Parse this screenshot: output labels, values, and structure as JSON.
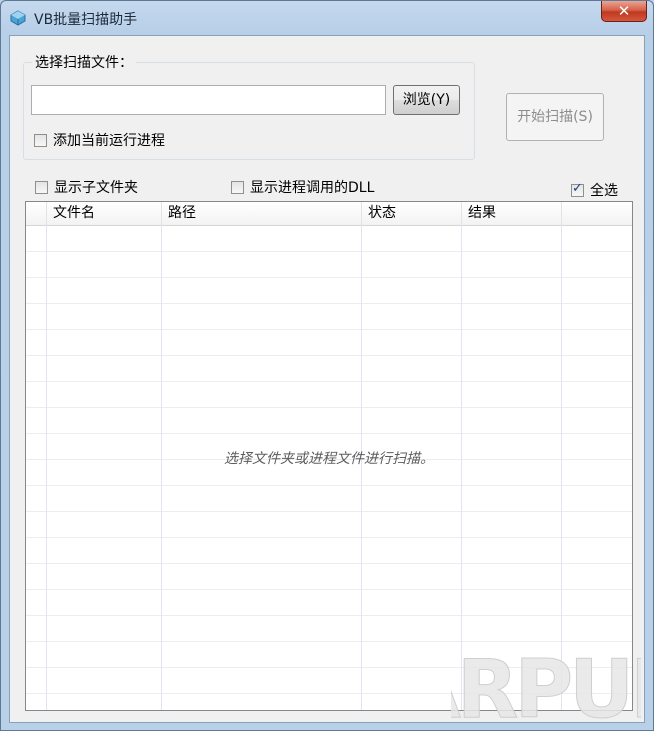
{
  "window": {
    "title": "VB批量扫描助手",
    "close_label": "✕"
  },
  "scan_group": {
    "label": "选择扫描文件：",
    "path_value": "",
    "browse_label": "浏览(Y)",
    "add_running_label": "添加当前运行进程",
    "add_running_checked": false
  },
  "start_scan_label": "开始扫描(S)",
  "options": {
    "show_subfolders_label": "显示子文件夹",
    "show_subfolders_checked": false,
    "show_dll_label": "显示进程调用的DLL",
    "show_dll_checked": false,
    "select_all_label": "全选",
    "select_all_checked": true
  },
  "list": {
    "columns": [
      "",
      "文件名",
      "路径",
      "状态",
      "结果",
      ""
    ],
    "empty_hint": "选择文件夹或进程文件进行扫描。"
  },
  "watermark_text": "ARPUN",
  "colors": {
    "title_bar": "#c5d9ee",
    "close_button": "#c0391f",
    "client_bg": "#f0f0f0"
  }
}
